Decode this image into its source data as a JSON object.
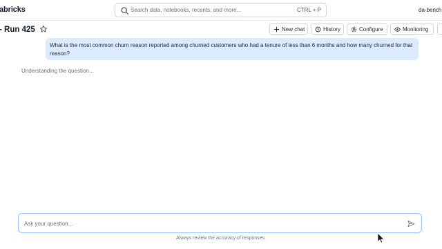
{
  "header": {
    "brand": "abricks",
    "search_placeholder": "Search data, notebooks, recents, and more...",
    "search_shortcut": "CTRL + P",
    "user": "da-bench"
  },
  "page": {
    "title": "- Run 425",
    "buttons": {
      "new_chat": "New chat",
      "history": "History",
      "configure": "Configure",
      "monitoring": "Monitoring"
    }
  },
  "chat": {
    "user_message": "What is the most common churn reason reported among churned customers who had a tenure of less than 6 months and how many churned for that reason?",
    "status": "Understanding the question..."
  },
  "composer": {
    "placeholder": "Ask your question...",
    "disclaimer": "Always review the accuracy of responses."
  },
  "colors": {
    "bubble": "#dbeafe",
    "input_border": "#93c5fd"
  },
  "icons": [
    "search-icon",
    "star-icon",
    "plus-icon",
    "history-icon",
    "gear-icon",
    "eye-icon",
    "send-icon",
    "mouse-cursor-icon"
  ]
}
